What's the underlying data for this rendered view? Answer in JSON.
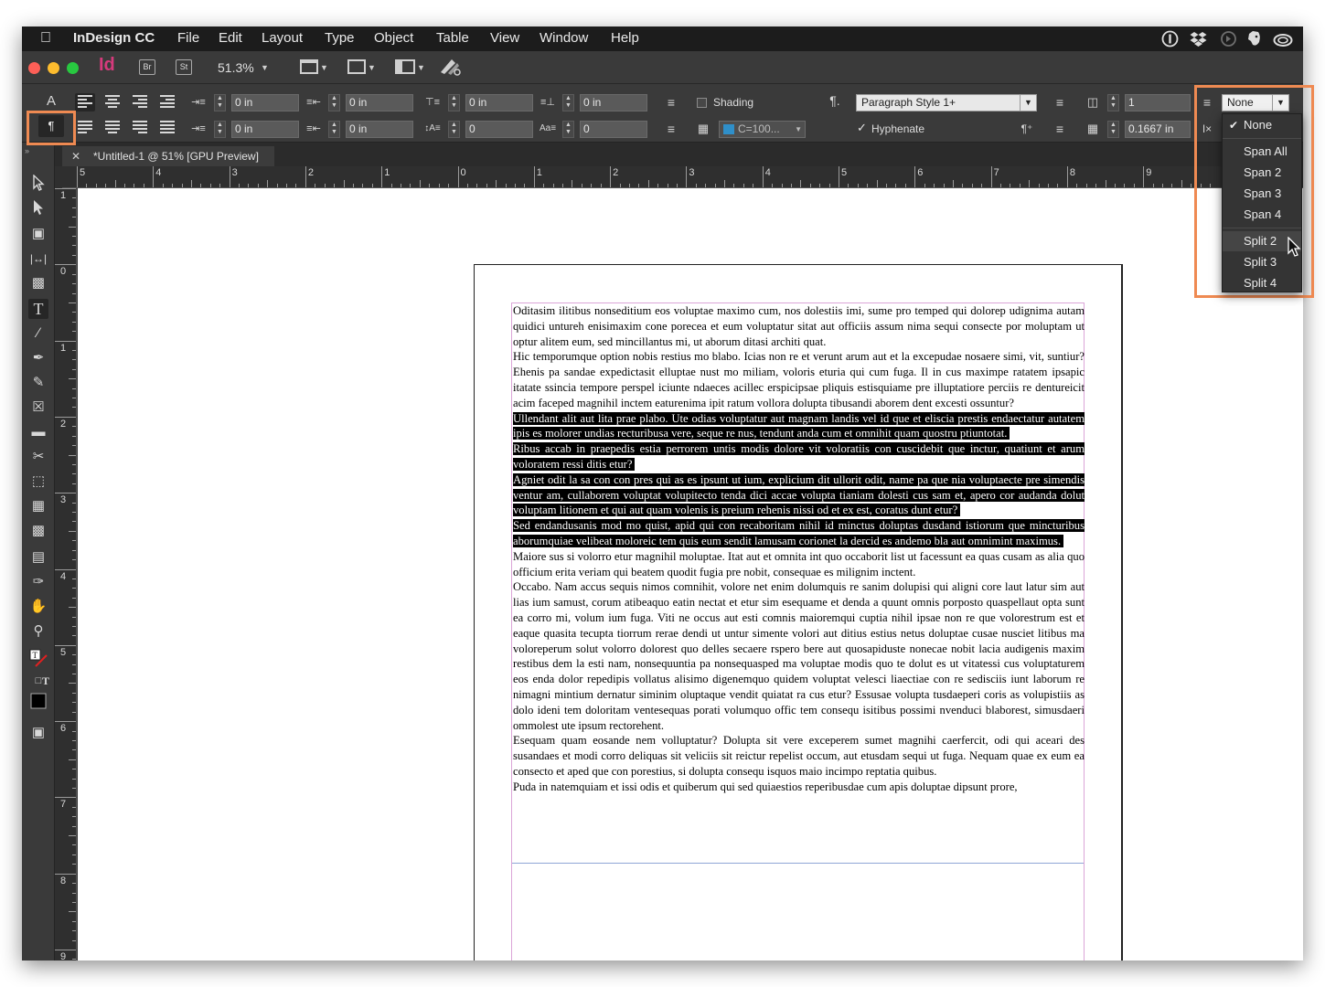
{
  "menubar": {
    "app": "InDesign CC",
    "items": [
      "File",
      "Edit",
      "Layout",
      "Type",
      "Object",
      "Table",
      "View",
      "Window",
      "Help"
    ],
    "tray_icons": [
      "1password-icon",
      "dropbox-icon",
      "sync-icon",
      "evernote-icon",
      "creative-cloud-icon"
    ]
  },
  "appbar": {
    "logo": "Id",
    "bridge": "Br",
    "stock": "St",
    "zoom": "51.3%"
  },
  "control": {
    "char_mode": "A",
    "para_mode": "¶",
    "left_indent": "0 in",
    "first_line_indent": "0 in",
    "right_indent": "0 in",
    "last_line_indent": "0 in",
    "space_before": "0 in",
    "space_after": "0 in",
    "drop_cap_lines": "0",
    "drop_cap_chars": "0",
    "shading_label": "Shading",
    "shading_color": "C=100...",
    "paragraph_style": "Paragraph Style 1+",
    "hyphenate_label": "Hyphenate",
    "columns": "1",
    "gutter": "0.1667 in",
    "span_value": "None"
  },
  "document": {
    "tab_title": "*Untitled-1 @ 51% [GPU Preview]"
  },
  "ruler": {
    "h_labels": [
      "5",
      "4",
      "3",
      "2",
      "1",
      "0",
      "1",
      "2",
      "3",
      "4",
      "5",
      "6",
      "7",
      "8",
      "9"
    ],
    "v_labels": [
      "1",
      "0",
      "1",
      "2",
      "3",
      "4",
      "5",
      "6",
      "7",
      "8",
      "9"
    ]
  },
  "text": {
    "paragraphs": [
      {
        "text": "Oditasim ilitibus nonseditium eos voluptae maximo cum, nos dolestiis imi, sume pro temped qui dolorep udignima autam quidici untureh enisimaxim cone porecea et eum voluptatur sitat aut officiis assum nima sequi consecte por moluptam ut optur alitem eum, sed mincillantus mi, ut aborum ditasi architi quat.",
        "selected": false
      },
      {
        "text": "Hic temporumque option nobis restius mo blabo. Icias non re et verunt arum aut et la excepudae nosaere simi, vit, suntiur? Ehenis pa sandae expedictasit elluptae nust mo miliam, voloris eturia qui cum fuga. Il in cus maximpe ratatem ipsapic itatate ssincia tempore perspel iciunte ndaeces acillec erspicipsae pliquis estisquiame pre illuptatiore perciis re dentureicit acim faceped magnihil inctem eaturenima ipit ratum vollora dolupta tibusandi aborem dent excesti ossuntur?",
        "selected": false
      },
      {
        "text": "Ullendant alit aut lita prae plabo. Ute odias voluptatur aut magnam landis vel id que et eliscia prestis endaectatur autatem ipis es molorer undias recturibusa vere, seque re nus, tendunt anda cum et omnihit quam quostru ptiuntotat.",
        "selected": true
      },
      {
        "text": "Ribus accab in praepedis estia perrorem untis modis dolore vit voloratiis con cuscidebit que inctur, quatiunt et arum voloratem ressi ditis etur?",
        "selected": true
      },
      {
        "text": "Agniet odit la sa con con pres qui as es ipsunt ut ium, explicium dit ullorit odit, name pa que nia voluptaecte pre simendis ventur am, cullaborem voluptat volupitecto tenda dici accae volupta tianiam dolesti cus sam et, apero cor audanda dolut voluptam litionem et qui aut quam volenis is preium rehenis nissi od et ex est, coratus dunt etur?",
        "selected": true
      },
      {
        "text": "Sed endandusanis mod mo quist, apid qui con recaboritam nihil id minctus doluptas dusdand istiorum que mincturibus aborumquiae velibeat moloreic tem quis eum sendit lamusam corionet la dercid es andemo bla aut omnimint maximus.",
        "selected": true
      },
      {
        "text": "Maiore sus si volorro etur magnihil moluptae. Itat aut et omnita int quo occaborit list ut facessunt ea quas cusam as alia quo officium erita veriam qui beatem quodit fugia pre nobit, consequae es milignim inctent.",
        "selected": false
      },
      {
        "text": "Occabo. Nam accus sequis nimos comnihit, volore net enim dolumquis re sanim dolupisi qui aligni core laut latur sim aut lias ium samust, corum atibeaquo eatin nectat et etur sim esequame et denda a quunt omnis porposto quaspellaut opta sunt ea corro mi, volum ium fuga. Viti ne occus aut esti comnis maioremqui cuptia nihil ipsae non re que volorestrum est et eaque quasita tecupta tiorrum rerae dendi ut untur simente volori aut ditius estius netus doluptae cusae nusciet litibus ma voloreperum solut volorro dolorest quo delles secaere rspero bere aut quosapiduste nonecae nobit lacia audigenis maxim restibus dem la esti nam, nonsequuntia pa nonsequasped ma voluptae modis quo te dolut es ut vitatessi cus voluptaturem eos enda dolor repedipis vollatus alisimo digenemquo quidem voluptat velesci liaectiae con re sedisciis iunt laborum re nimagni mintium dernatur siminim oluptaque vendit quiatat ra cus etur? Essusae volupta tusdaeperi coris as volupistiis as dolo ideni tem doloritam ventesequas porati volumquo offic tem consequ isitibus possimi nvenduci blaborest, simusdaeri ommolest ute ipsum rectorehent.",
        "selected": false
      },
      {
        "text": "Esequam quam eosande nem volluptatur? Dolupta sit vere exceperem sumet magnihi caerfercit, odi qui aceari des susandaes et modi corro deliquas sit veliciis sit reictur repelist occum, aut etusdam sequi ut fuga. Nequam quae ex eum ea consecto et aped que con porestius, si dolupta consequ isquos maio incimpo reptatia quibus.",
        "selected": false
      },
      {
        "text": "Puda in natemquiam et issi odis et quiberum qui sed quiaestios reperibusdae cum apis doluptae dipsunt prore,",
        "selected": false
      }
    ]
  },
  "span_menu": {
    "items": [
      {
        "label": "None",
        "checked": true
      },
      {
        "label": "Span All",
        "checked": false
      },
      {
        "label": "Span 2",
        "checked": false
      },
      {
        "label": "Span 3",
        "checked": false
      },
      {
        "label": "Span 4",
        "checked": false
      },
      {
        "label": "Split 2",
        "checked": false,
        "hover": true
      },
      {
        "label": "Split 3",
        "checked": false
      },
      {
        "label": "Split 4",
        "checked": false
      }
    ]
  },
  "colors": {
    "callout": "#ef8a52",
    "selection": "#000000",
    "frame_edge": "#dba5d8",
    "swatch": "#2f8fc9",
    "indesign_pink": "#d63a7c"
  }
}
